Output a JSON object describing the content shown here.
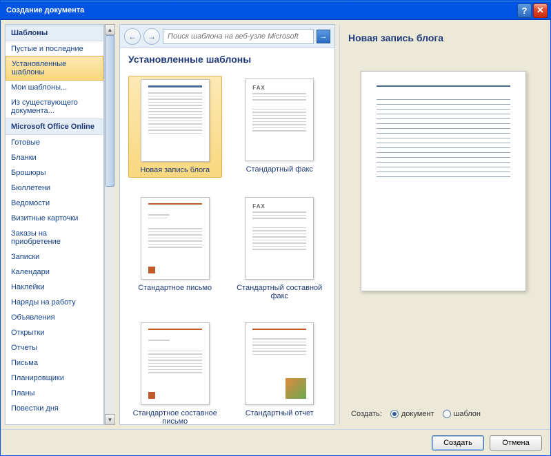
{
  "title": "Создание документа",
  "sidebar": {
    "heading1": "Шаблоны",
    "items1": [
      "Пустые и последние",
      "Установленные шаблоны",
      "Мои шаблоны...",
      "Из существующего документа..."
    ],
    "heading2": "Microsoft Office Online",
    "items2": [
      "Готовые",
      "Бланки",
      "Брошюры",
      "Бюллетени",
      "Ведомости",
      "Визитные карточки",
      "Заказы на приобретение",
      "Записки",
      "Календари",
      "Наклейки",
      "Наряды на работу",
      "Объявления",
      "Открытки",
      "Отчеты",
      "Письма",
      "Планировщики",
      "Планы",
      "Повестки дня"
    ],
    "selected": "Установленные шаблоны"
  },
  "search": {
    "placeholder": "Поиск шаблона на веб-узле Microsoft"
  },
  "center_heading": "Установленные шаблоны",
  "templates": [
    {
      "id": "blog",
      "label": "Новая запись блога",
      "selected": true
    },
    {
      "id": "fax",
      "label": "Стандартный факс",
      "selected": false
    },
    {
      "id": "letter",
      "label": "Стандартное письмо",
      "selected": false
    },
    {
      "id": "mergefax",
      "label": "Стандартный составной факс",
      "selected": false
    },
    {
      "id": "mergeletter",
      "label": "Стандартное составное письмо",
      "selected": false
    },
    {
      "id": "report",
      "label": "Стандартный отчет",
      "selected": false
    }
  ],
  "preview": {
    "title": "Новая запись блога"
  },
  "create": {
    "label": "Создать:",
    "opt_doc": "документ",
    "opt_tpl": "шаблон"
  },
  "buttons": {
    "create": "Создать",
    "cancel": "Отмена"
  }
}
